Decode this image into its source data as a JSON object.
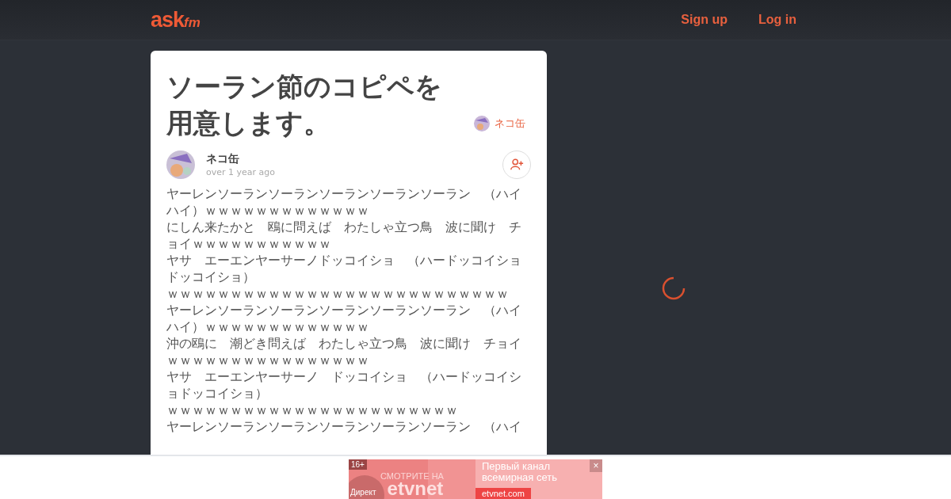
{
  "header": {
    "logo": {
      "main": "ask",
      "suffix": "fm"
    },
    "links": [
      {
        "label": "Sign up"
      },
      {
        "label": "Log in"
      }
    ]
  },
  "question": {
    "title": "ソーラン節のコピペを用意します。",
    "asker": "ネコ缶"
  },
  "answer": {
    "author": "ネコ缶",
    "time": "over 1 year ago",
    "lines": [
      "ヤーレンソーランソーランソーランソーランソーラン　（ハイハイ）ｗｗｗｗｗｗｗｗｗｗｗｗｗ",
      "にしん来たかと　鴎に問えば　わたしゃ立つ鳥　波に聞け　チョイｗｗｗｗｗｗｗｗｗｗｗ",
      "ヤサ　エーエンヤーサーノドッコイショ　（ハードッコイショドッコイショ）",
      "ｗｗｗｗｗｗｗｗｗｗｗｗｗｗｗｗｗｗｗｗｗｗｗｗｗｗｗ",
      "ヤーレンソーランソーランソーランソーランソーラン　（ハイハイ）ｗｗｗｗｗｗｗｗｗｗｗｗｗ",
      "沖の鴎に　潮どき問えば　わたしゃ立つ鳥　波に聞け　チョイｗｗｗｗｗｗｗｗｗｗｗｗｗｗｗｗ",
      "ヤサ　エーエンヤーサーノ　ドッコイショ　（ハードッコイショドッコイショ）",
      "ｗｗｗｗｗｗｗｗｗｗｗｗｗｗｗｗｗｗｗｗｗｗｗ",
      "ヤーレンソーランソーランソーランソーランソーラン　（ハイ"
    ]
  },
  "ad": {
    "age": "16+",
    "tagline": "СМОТРИТЕ НА",
    "brand": "etvnet",
    "source": "Директ",
    "headline": "Первый канал всемирная сеть",
    "url": "etvnet.com",
    "close": "×"
  }
}
